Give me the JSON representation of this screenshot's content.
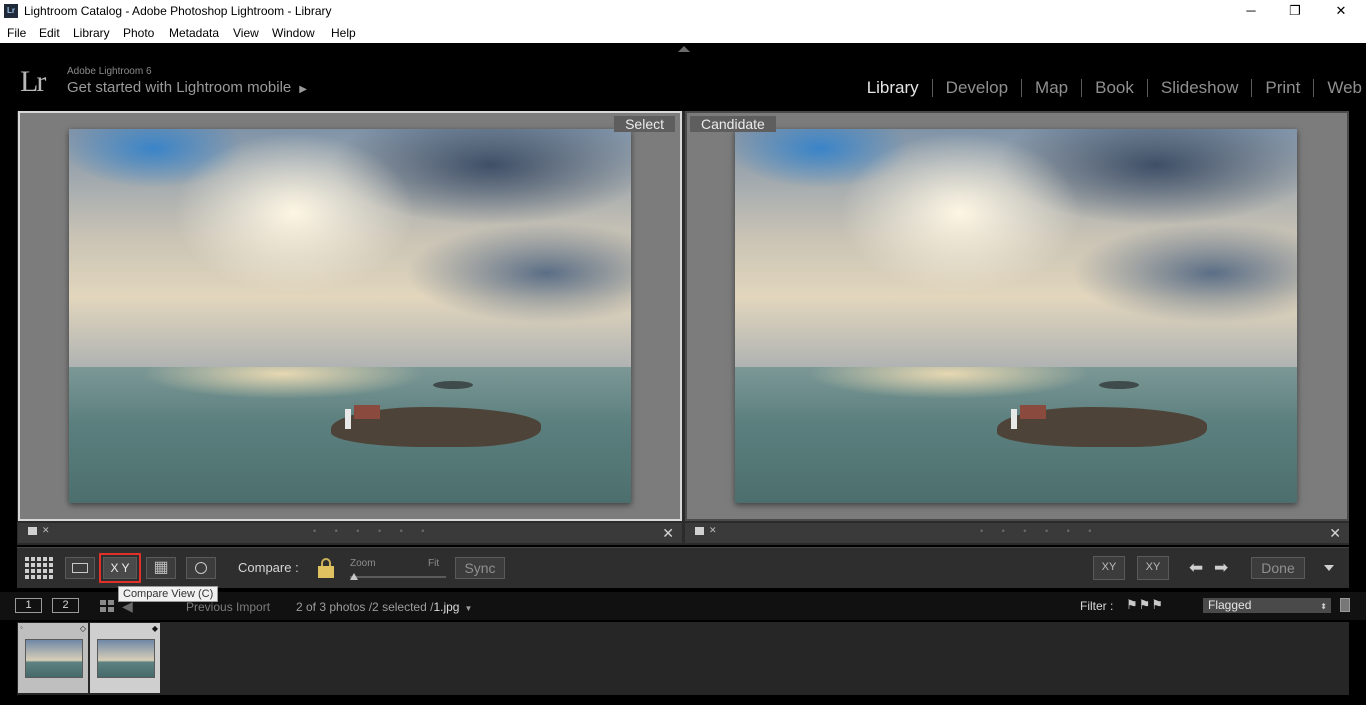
{
  "window": {
    "app_icon": "Lr",
    "title": "Lightroom Catalog - Adobe Photoshop Lightroom - Library",
    "minimize": "─",
    "maximize": "❐",
    "close": "✕"
  },
  "menu": [
    "File",
    "Edit",
    "Library",
    "Photo",
    "Metadata",
    "View",
    "Window",
    "Help"
  ],
  "identity": {
    "logo": "Lr",
    "product": "Adobe Lightroom 6",
    "mobile_prompt": "Get started with Lightroom mobile",
    "mobile_arrow": "▶"
  },
  "modules": [
    {
      "label": "Library",
      "active": true
    },
    {
      "label": "Develop",
      "active": false
    },
    {
      "label": "Map",
      "active": false
    },
    {
      "label": "Book",
      "active": false
    },
    {
      "label": "Slideshow",
      "active": false
    },
    {
      "label": "Print",
      "active": false
    },
    {
      "label": "Web",
      "active": false
    }
  ],
  "compare": {
    "select_label": "Select",
    "candidate_label": "Candidate",
    "footer_dots": "• • • • • •",
    "footer_close": "✕",
    "footer_reject": "✕"
  },
  "toolbar": {
    "survey_text": "X|Y",
    "compare_btn": "X Y",
    "compare_label": "Compare :",
    "zoom_label": "Zoom",
    "fit_label": "Fit",
    "sync_label": "Sync",
    "swap_label": "XY",
    "make_select_label": "XY",
    "prev_arrow": "⬅",
    "next_arrow": "➡",
    "done_label": "Done",
    "tooltip": "Compare View (C)",
    "survey_grid": "▦"
  },
  "filmbar": {
    "screen1": "1",
    "screen2": "2",
    "prev_icon": "◀",
    "next_icon": "▶",
    "source": "Previous Import",
    "count": "2 of 3 photos /2 selected /",
    "filename": "1.jpg",
    "caret": "▼",
    "filter_label": "Filter :",
    "filter_flags": "⚑⚑⚑",
    "filter_value": "Flagged",
    "filter_arrow": "⬍"
  },
  "colors": {
    "background": "#000000",
    "panel": "#2e2e2e",
    "active_module": "#e6e6e6",
    "highlight_outline": "#e0302a"
  }
}
